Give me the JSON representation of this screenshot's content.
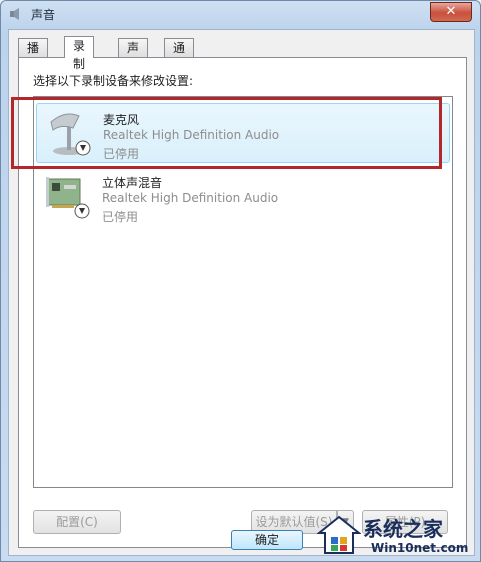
{
  "window": {
    "title": "声音",
    "close_label": "✕"
  },
  "tabs": [
    {
      "label": "播放"
    },
    {
      "label": "录制"
    },
    {
      "label": "声音"
    },
    {
      "label": "通信"
    }
  ],
  "panel": {
    "instruction": "选择以下录制设备来修改设置:"
  },
  "devices": [
    {
      "name": "麦克风",
      "description": "Realtek High Definition Audio",
      "status": "已停用"
    },
    {
      "name": "立体声混音",
      "description": "Realtek High Definition Audio",
      "status": "已停用"
    }
  ],
  "buttons": {
    "configure": "配置(C)",
    "set_default": "设为默认值(S)",
    "properties": "属性(P)",
    "ok": "确定"
  },
  "watermark": {
    "brand": "系统之家",
    "url": "Win10net.com"
  },
  "colors": {
    "highlight": "#b3262a",
    "selection": "#d9f0fc"
  }
}
